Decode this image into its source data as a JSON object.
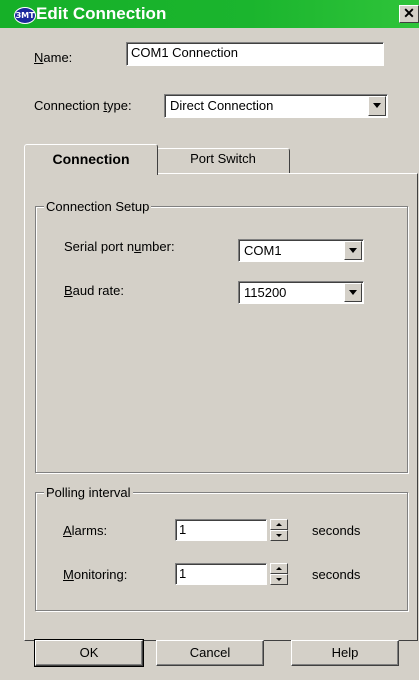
{
  "window": {
    "title": "Edit Connection",
    "icon": "app-logo-icon",
    "icon_text": "ЗМТ",
    "close_symbol": "✕"
  },
  "name_field": {
    "label_prefix": "",
    "label_accel": "N",
    "label_rest": "ame:",
    "value": "COM1 Connection"
  },
  "connection_type": {
    "label_prefix": "Connection ",
    "label_accel": "t",
    "label_rest": "ype:",
    "value": "Direct Connection"
  },
  "tabs": [
    {
      "label": "Connection",
      "active": true
    },
    {
      "label": "Port Switch",
      "active": false
    }
  ],
  "connection_setup": {
    "title": "Connection Setup",
    "serial_port": {
      "label_prefix": "Serial port n",
      "label_accel": "u",
      "label_rest": "mber:",
      "value": "COM1"
    },
    "baud_rate": {
      "label_prefix": "",
      "label_accel": "B",
      "label_rest": "aud rate:",
      "value": "115200"
    }
  },
  "polling_interval": {
    "title": "Polling interval",
    "alarms": {
      "label_prefix": "",
      "label_accel": "A",
      "label_rest": "larms:",
      "value": "1",
      "unit": "seconds"
    },
    "monitoring": {
      "label_prefix": "",
      "label_accel": "M",
      "label_rest": "onitoring:",
      "value": "1",
      "unit": "seconds"
    }
  },
  "buttons": {
    "ok": "OK",
    "cancel": "Cancel",
    "help": "Help"
  },
  "colors": {
    "titlebar": "#1bb52e",
    "face": "#d4d0c8",
    "field": "#ffffff"
  }
}
